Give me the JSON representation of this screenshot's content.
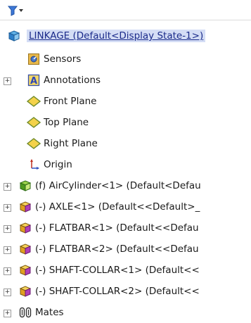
{
  "tree": {
    "root": {
      "label": "LINKAGE  (Default<Display State-1>)"
    },
    "items": [
      {
        "label": "Sensors",
        "icon": "sensors-icon"
      },
      {
        "label": "Annotations",
        "icon": "annotations-icon"
      },
      {
        "label": "Front Plane",
        "icon": "plane-icon"
      },
      {
        "label": "Top Plane",
        "icon": "plane-icon"
      },
      {
        "label": "Right Plane",
        "icon": "plane-icon"
      },
      {
        "label": "Origin",
        "icon": "origin-icon"
      },
      {
        "label": "(f) AirCylinder<1> (Default<Defau",
        "icon": "subassembly-icon"
      },
      {
        "label": "(-) AXLE<1> (Default<<Default>_",
        "icon": "part-icon"
      },
      {
        "label": "(-) FLATBAR<1> (Default<<Defau",
        "icon": "part-icon"
      },
      {
        "label": "(-) FLATBAR<2> (Default<<Defau",
        "icon": "part-icon"
      },
      {
        "label": "(-) SHAFT-COLLAR<1> (Default<<",
        "icon": "part-icon"
      },
      {
        "label": "(-) SHAFT-COLLAR<2> (Default<<",
        "icon": "part-icon"
      },
      {
        "label": "Mates",
        "icon": "mates-icon"
      }
    ]
  }
}
